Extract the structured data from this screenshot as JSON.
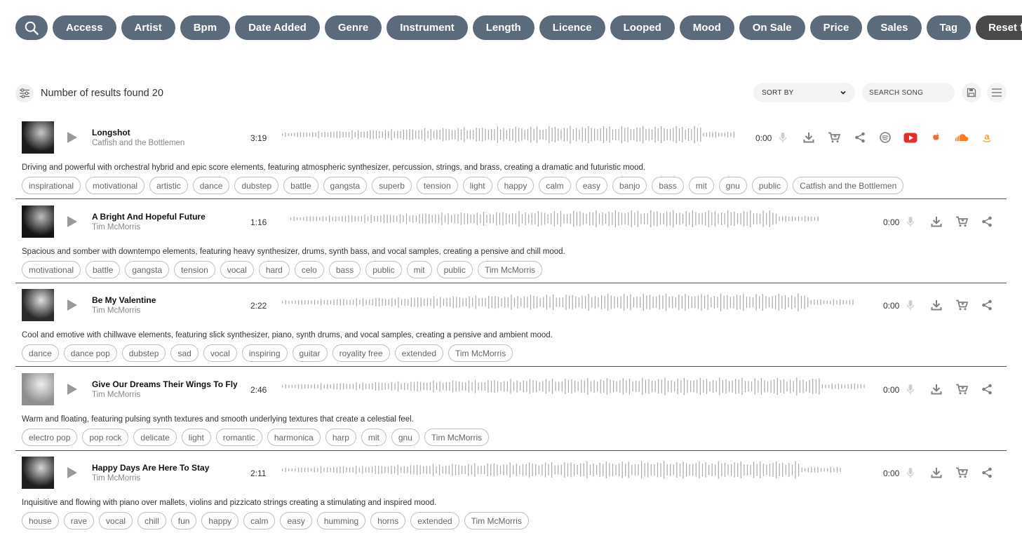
{
  "filters": {
    "items": [
      "Access",
      "Artist",
      "Bpm",
      "Date Added",
      "Genre",
      "Instrument",
      "Length",
      "Licence",
      "Looped",
      "Mood",
      "On Sale",
      "Price",
      "Sales",
      "Tag"
    ],
    "reset_label": "Reset filter",
    "search_icon": "search-icon"
  },
  "results": {
    "label": "Number of results found 20",
    "sort_label": "SORT BY",
    "search_placeholder": "SEARCH SONG"
  },
  "colors": {
    "pill": "#5b6b7c",
    "reset": "#4a4a4a",
    "youtube": "#e52d27",
    "apple": "#f26b3a",
    "soundcloud": "#ff7a1a",
    "amazon": "#f0a030"
  },
  "tracks": [
    {
      "title": "Longshot",
      "artist": "Catfish and the Bottlemen",
      "duration": "3:19",
      "current": "0:00",
      "description": "Driving and powerful with orchestral hybrid and epic score elements, featuring atmospheric synthesizer, percussion, strings, and brass, creating a dramatic and futuristic mood.",
      "tags": [
        "inspirational",
        "motivational",
        "artistic",
        "dance",
        "dubstep",
        "battle",
        "gangsta",
        "superb",
        "tension",
        "light",
        "happy",
        "calm",
        "easy",
        "banjo",
        "bass",
        "mit",
        "gnu",
        "public",
        "Catfish and the Bottlemen"
      ],
      "stores": [
        "spotify-icon",
        "youtube-icon",
        "apple-music-icon",
        "soundcloud-icon",
        "amazon-icon"
      ]
    },
    {
      "title": "A Bright And Hopeful Future",
      "artist": "Tim McMorris",
      "duration": "1:16",
      "current": "0:00",
      "description": "Spacious and somber with downtempo elements, featuring heavy synthesizer, drums, synth bass, and vocal samples, creating a pensive and chill mood.",
      "tags": [
        "motivational",
        "battle",
        "gangsta",
        "tension",
        "vocal",
        "hard",
        "celo",
        "bass",
        "public",
        "mit",
        "public",
        "Tim McMorris"
      ],
      "stores": []
    },
    {
      "title": "Be My Valentine",
      "artist": "Tim McMorris",
      "duration": "2:22",
      "current": "0:00",
      "description": "Cool and emotive with chillwave elements, featuring slick synthesizer, piano, synth drums, and vocal samples, creating a pensive and ambient mood.",
      "tags": [
        "dance",
        "dance pop",
        "dubstep",
        "sad",
        "vocal",
        "inspiring",
        "guitar",
        "royality free",
        "extended",
        "Tim McMorris"
      ],
      "stores": []
    },
    {
      "title": "Give Our Dreams Their Wings To Fly",
      "artist": "Tim McMorris",
      "duration": "2:46",
      "current": "0:00",
      "description": "Warm and floating, featuring pulsing synth textures and smooth underlying textures that create a celestial feel.",
      "tags": [
        "electro pop",
        "pop rock",
        "delicate",
        "light",
        "romantic",
        "harmonica",
        "harp",
        "mit",
        "gnu",
        "Tim McMorris"
      ],
      "stores": []
    },
    {
      "title": "Happy Days Are Here To Stay",
      "artist": "Tim McMorris",
      "duration": "2:11",
      "current": "0:00",
      "description": "Inquisitive and flowing with piano over mallets, violins and pizzicato strings creating a stimulating and inspired mood.",
      "tags": [
        "house",
        "rave",
        "vocal",
        "chill",
        "fun",
        "happy",
        "calm",
        "easy",
        "humming",
        "horns",
        "extended",
        "Tim McMorris"
      ],
      "stores": []
    }
  ]
}
